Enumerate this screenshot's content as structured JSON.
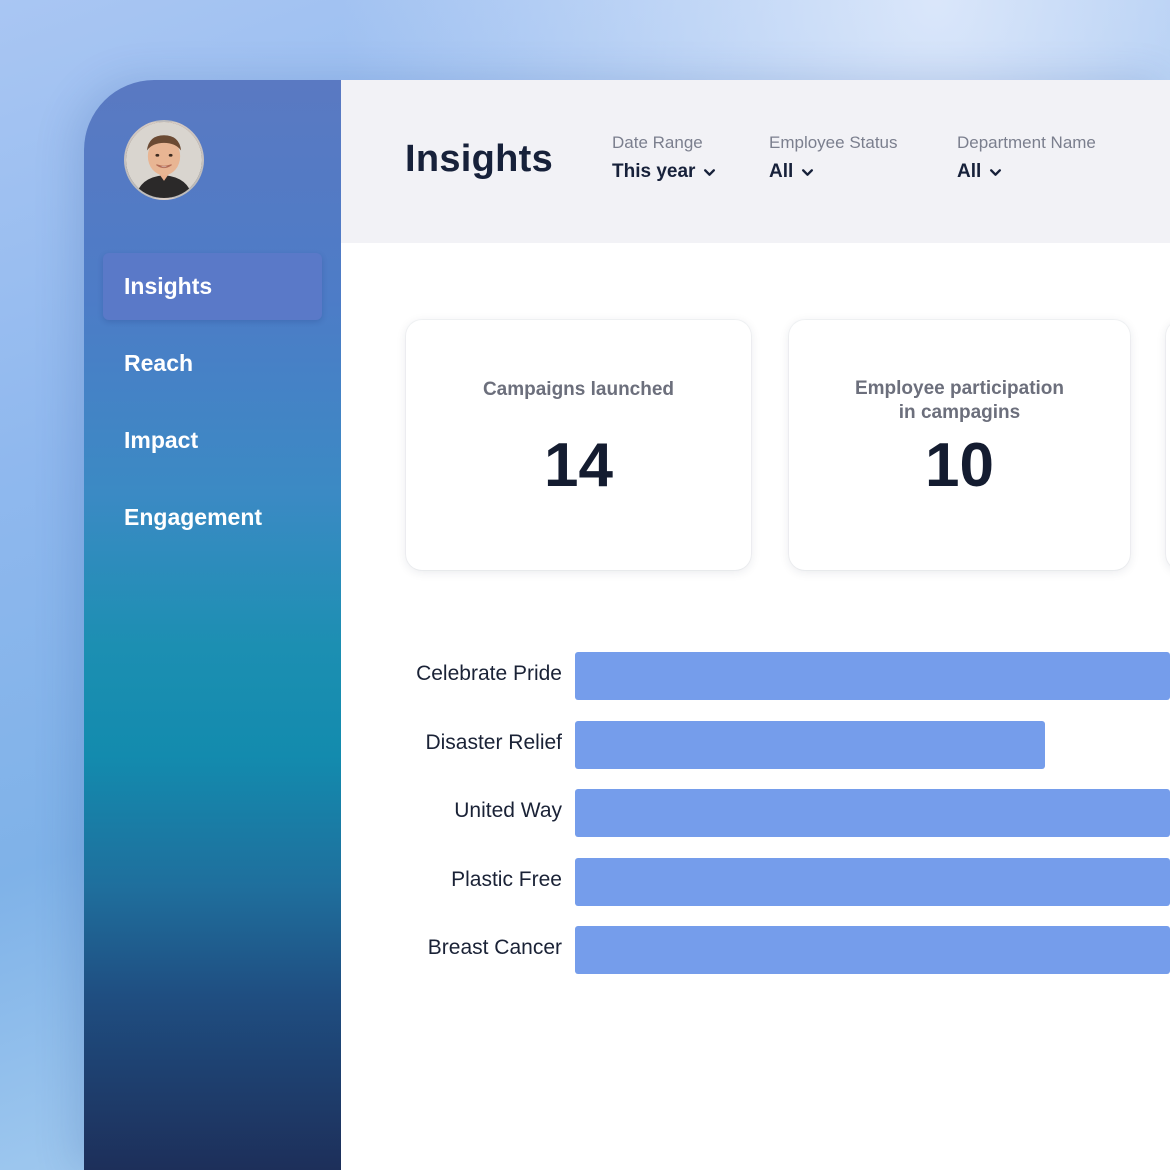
{
  "sidebar": {
    "items": [
      {
        "label": "Insights",
        "active": true
      },
      {
        "label": "Reach",
        "active": false
      },
      {
        "label": "Impact",
        "active": false
      },
      {
        "label": "Engagement",
        "active": false
      }
    ]
  },
  "header": {
    "title": "Insights",
    "filters": [
      {
        "label": "Date Range",
        "value": "This year"
      },
      {
        "label": "Employee Status",
        "value": "All"
      },
      {
        "label": "Department Name",
        "value": "All"
      }
    ]
  },
  "cards": [
    {
      "label": "Campaigns launched",
      "value": "14"
    },
    {
      "label_line1": "Employee participation",
      "label_line2": "in campagins",
      "value": "10"
    }
  ],
  "colors": {
    "accent": "#759deb",
    "active_nav": "#5a79c8",
    "title": "#17213a"
  },
  "chart_data": {
    "type": "bar",
    "orientation": "horizontal",
    "categories": [
      "Celebrate Pride",
      "Disaster Relief",
      "United Way",
      "Plastic Free",
      "Breast Cancer"
    ],
    "values": [
      1.0,
      0.79,
      1.0,
      1.0,
      1.0
    ],
    "xlim": [
      0,
      1
    ],
    "grid": false
  }
}
